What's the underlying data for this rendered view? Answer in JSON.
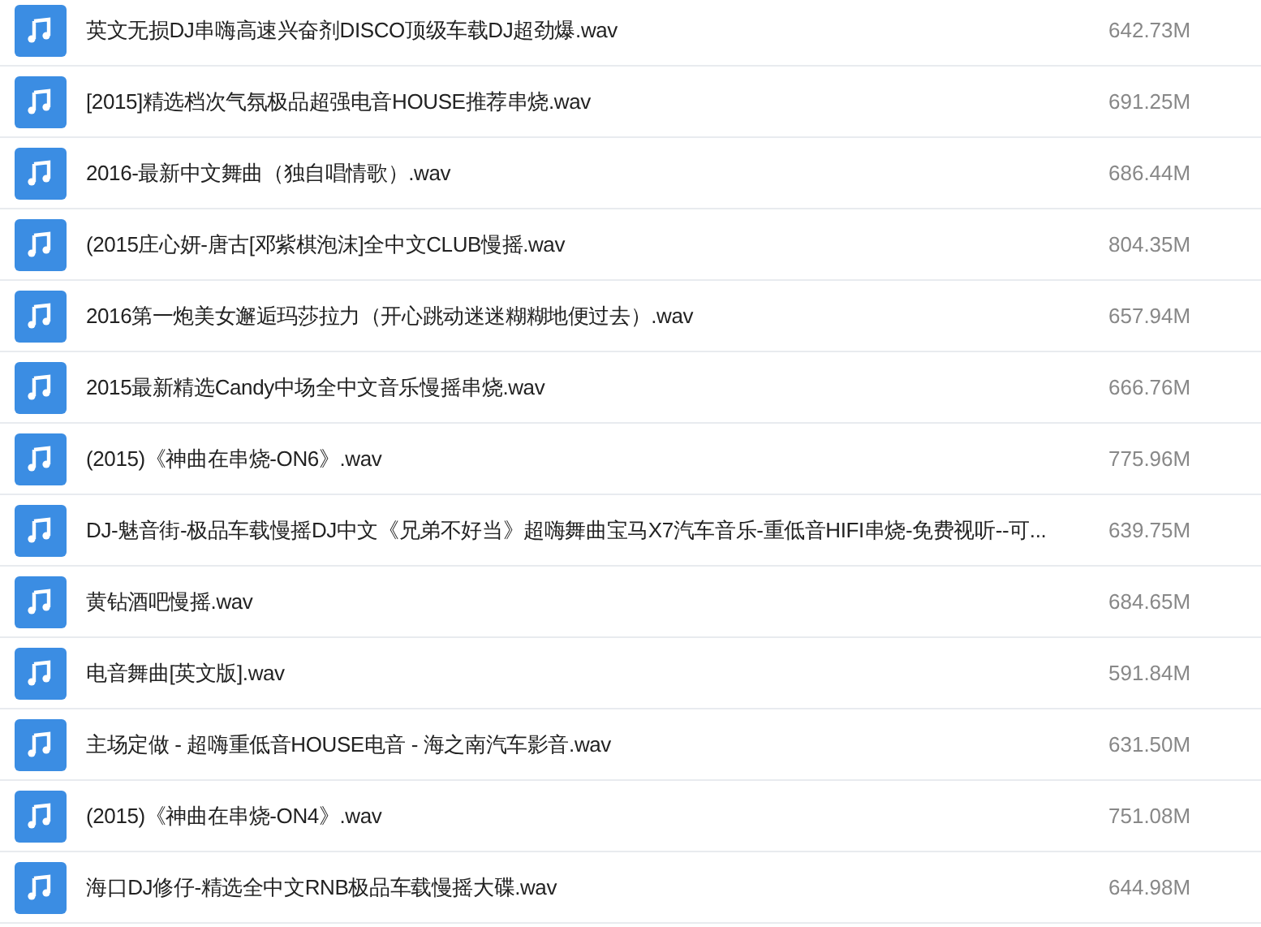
{
  "files": [
    {
      "name": "英文无损DJ串嗨高速兴奋剂DISCO顶级车载DJ超劲爆.wav",
      "size": "642.73M"
    },
    {
      "name": "[2015]精选档次气氛极品超强电音HOUSE推荐串烧.wav",
      "size": "691.25M"
    },
    {
      "name": "2016-最新中文舞曲（独自唱情歌）.wav",
      "size": "686.44M"
    },
    {
      "name": "(2015庄心妍-唐古[邓紫棋泡沫]全中文CLUB慢摇.wav",
      "size": "804.35M"
    },
    {
      "name": "2016第一炮美女邂逅玛莎拉力（开心跳动迷迷糊糊地便过去）.wav",
      "size": "657.94M"
    },
    {
      "name": "2015最新精选Candy中场全中文音乐慢摇串烧.wav",
      "size": "666.76M"
    },
    {
      "name": "(2015)《神曲在串烧-ON6》.wav",
      "size": "775.96M"
    },
    {
      "name": "DJ-魅音街-极品车载慢摇DJ中文《兄弟不好当》超嗨舞曲宝马X7汽车音乐-重低音HIFI串烧-免费视听--可...",
      "size": "639.75M"
    },
    {
      "name": "黄钻酒吧慢摇.wav",
      "size": "684.65M"
    },
    {
      "name": "电音舞曲[英文版].wav",
      "size": "591.84M"
    },
    {
      "name": "主场定做 - 超嗨重低音HOUSE电音 - 海之南汽车影音.wav",
      "size": "631.50M"
    },
    {
      "name": "(2015)《神曲在串烧-ON4》.wav",
      "size": "751.08M"
    },
    {
      "name": "海口DJ修仔-精选全中文RNB极品车载慢摇大碟.wav",
      "size": "644.98M"
    }
  ]
}
